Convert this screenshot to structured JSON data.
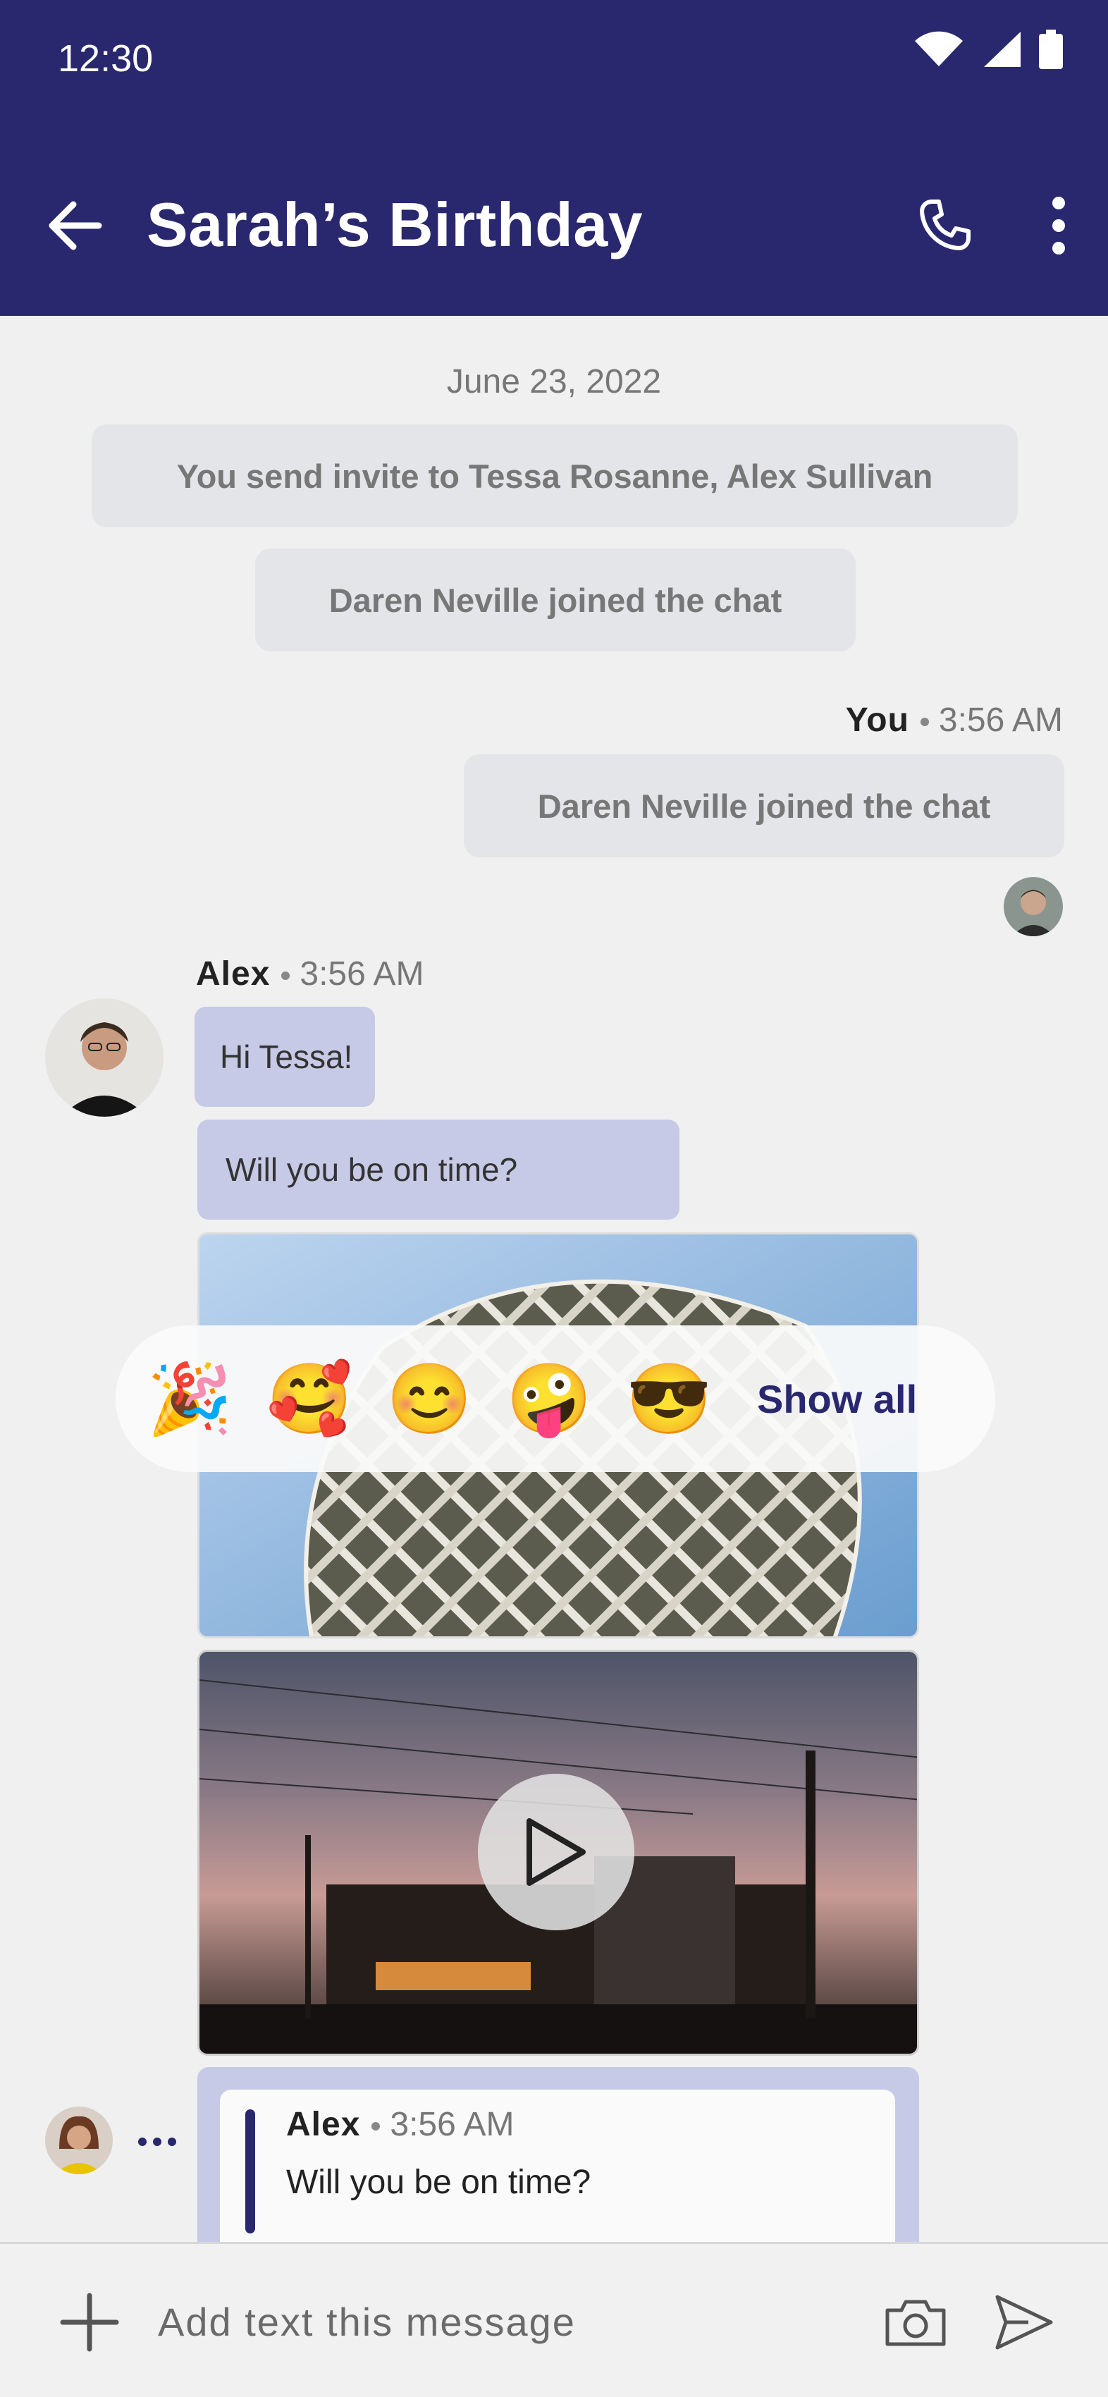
{
  "status_bar": {
    "time": "12:30",
    "icons": [
      "wifi-icon",
      "signal-icon",
      "battery-icon"
    ]
  },
  "app_bar": {
    "title": "Sarah’s Birthday",
    "icons": [
      "back-arrow-icon",
      "phone-icon",
      "more-vert-icon"
    ]
  },
  "chat": {
    "date": "June 23, 2022",
    "system_messages": [
      "You send invite to Tessa Rosanne, Alex Sullivan",
      "Daren Neville joined the chat"
    ],
    "own_message": {
      "sender": "You",
      "time": "3:56 AM",
      "text": "Daren Neville joined the chat"
    },
    "alex_group": {
      "sender": "Alex",
      "time": "3:56 AM",
      "messages": [
        "Hi Tessa!",
        "Will you be on time?"
      ]
    },
    "reactions": {
      "emojis": [
        "🎉",
        "🥰",
        "😊",
        "🤪",
        "😎"
      ],
      "show_all": "Show all"
    },
    "reply_preview": {
      "sender": "Alex",
      "time": "3:56 AM",
      "text": "Will you be on time?"
    }
  },
  "composer": {
    "placeholder": "Add text this message",
    "icons": [
      "plus-icon",
      "camera-icon",
      "send-icon"
    ]
  },
  "colors": {
    "primary": "#29286f",
    "bubble": "#c7cae6",
    "system_bubble": "#e4e5e8",
    "background": "#f0f0f0"
  }
}
